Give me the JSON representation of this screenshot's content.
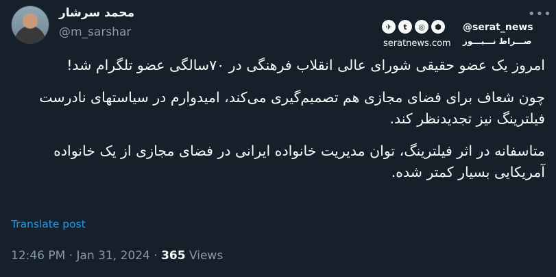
{
  "author": {
    "name": "محمد سرشار",
    "handle": "@m_sarshar"
  },
  "more_icon": "more-horizontal-icon",
  "watermark": {
    "icons": [
      "telegram-icon",
      "twitter-icon",
      "instagram-icon",
      "aparat-icon"
    ],
    "handle": "@serat_news",
    "site": "seratnews.com",
    "brand": "صـــراط نـــیـــوز"
  },
  "tweet": {
    "paragraphs": [
      "امروز یک عضو حقیقی شورای عالی انقلاب فرهنگی در ۷۰سالگی عضو تلگرام شد!",
      "چون شعاف برای فضای مجازی هم تصمیم‌گیری می‌کند، امیدوارم در سیاستهای نادرست فیلترینگ نیز تجدیدنظر کند.",
      "متاسفانه در اثر فیلترینگ، توان مدیریت خانواده ایرانی در فضای مجازی از یک خانواده آمریکایی بسیار کمتر شده."
    ],
    "translate_label": "Translate post"
  },
  "meta": {
    "time": "12:46 PM",
    "sep1": " · ",
    "date": "Jan 31, 2024",
    "sep2": " · ",
    "views_count": "365",
    "views_label": " Views"
  }
}
